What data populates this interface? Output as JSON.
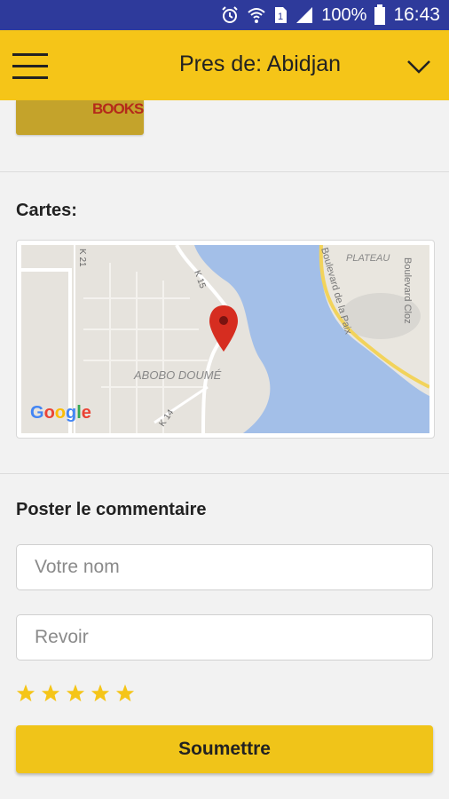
{
  "status_bar": {
    "battery": "100%",
    "time": "16:43",
    "icons": [
      "alarm-icon",
      "wifi-icon",
      "sim-icon",
      "signal-icon",
      "battery-icon"
    ]
  },
  "app_bar": {
    "title": "Pres de: Abidjan",
    "menu_icon": "hamburger-icon",
    "dropdown_icon": "chevron-down-icon",
    "background": "#f5c518"
  },
  "listing": {
    "thumbnail_text": "BOOKS"
  },
  "map_section": {
    "label": "Cartes:",
    "map_labels": [
      "ABOBO DOUMÉ",
      "PLATEAU",
      "Boulevard de la Paix",
      "Boulevard Cloz",
      "K 14",
      "K 21",
      "K 15"
    ],
    "google_logo": "Google"
  },
  "comment_section": {
    "label": "Poster le commentaire",
    "name_placeholder": "Votre nom",
    "review_placeholder": "Revoir",
    "rating": 5,
    "rating_max": 5,
    "submit_label": "Soumettre",
    "star_color": "#f5c518"
  }
}
